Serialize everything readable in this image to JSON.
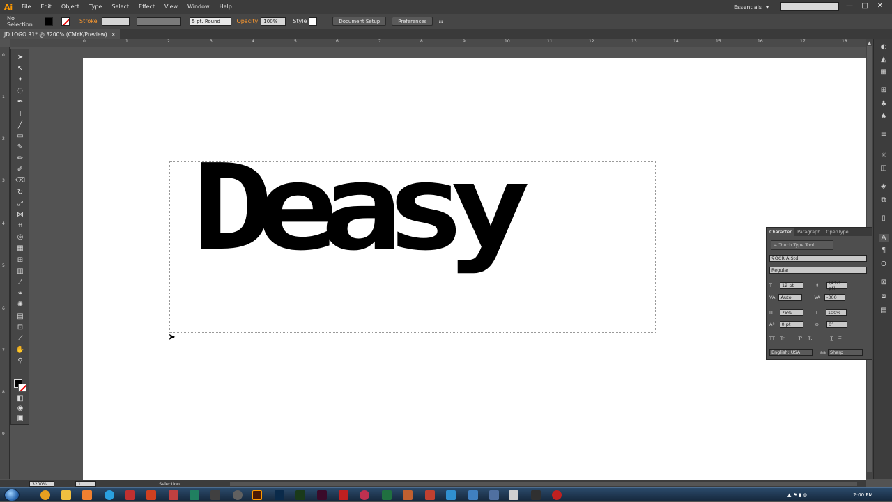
{
  "app": {
    "logo": "Ai"
  },
  "menus": [
    "File",
    "Edit",
    "Object",
    "Type",
    "Select",
    "Effect",
    "View",
    "Window",
    "Help"
  ],
  "workspace": {
    "label": "Essentials"
  },
  "window_controls": [
    "—",
    "□",
    "✕"
  ],
  "control_bar": {
    "selection": "No Selection",
    "stroke_label": "Stroke",
    "brush": "5 pt. Round",
    "opacity_label": "Opacity",
    "opacity_value": "100%",
    "style_label": "Style",
    "document_setup": "Document Setup",
    "preferences": "Preferences"
  },
  "document_tab": {
    "title": "JD LOGO R1* @ 3200% (CMYK/Preview)",
    "close": "×"
  },
  "ruler_top": [
    "0",
    "1",
    "2",
    "3",
    "4",
    "5",
    "6",
    "7",
    "8",
    "9",
    "10",
    "11",
    "12",
    "13",
    "14",
    "15",
    "16",
    "17",
    "18"
  ],
  "ruler_left": [
    "0",
    "1",
    "2",
    "3",
    "4",
    "5",
    "6",
    "7",
    "8",
    "9"
  ],
  "canvas": {
    "text": "Deasy"
  },
  "character_panel": {
    "tabs": [
      "Character",
      "Paragraph",
      "OpenType"
    ],
    "touch_type": "Touch Type Tool",
    "font_family": "OCR A Std",
    "font_style": "Regular",
    "font_size": "12 pt",
    "leading": "(14.4 pt)",
    "kerning": "Auto",
    "tracking": "-300",
    "vertical_scale": "75%",
    "horizontal_scale": "100%",
    "baseline_shift": "0 pt",
    "rotation": "0°",
    "language": "English: USA",
    "antialias": "Sharp"
  },
  "status": {
    "zoom": "3200%",
    "page": "1",
    "tool": "Selection"
  },
  "taskbar": {
    "time": "2:00 PM"
  },
  "colors": {
    "accent": "#ff9a00",
    "canvas": "#ffffff",
    "chrome": "#535353"
  }
}
